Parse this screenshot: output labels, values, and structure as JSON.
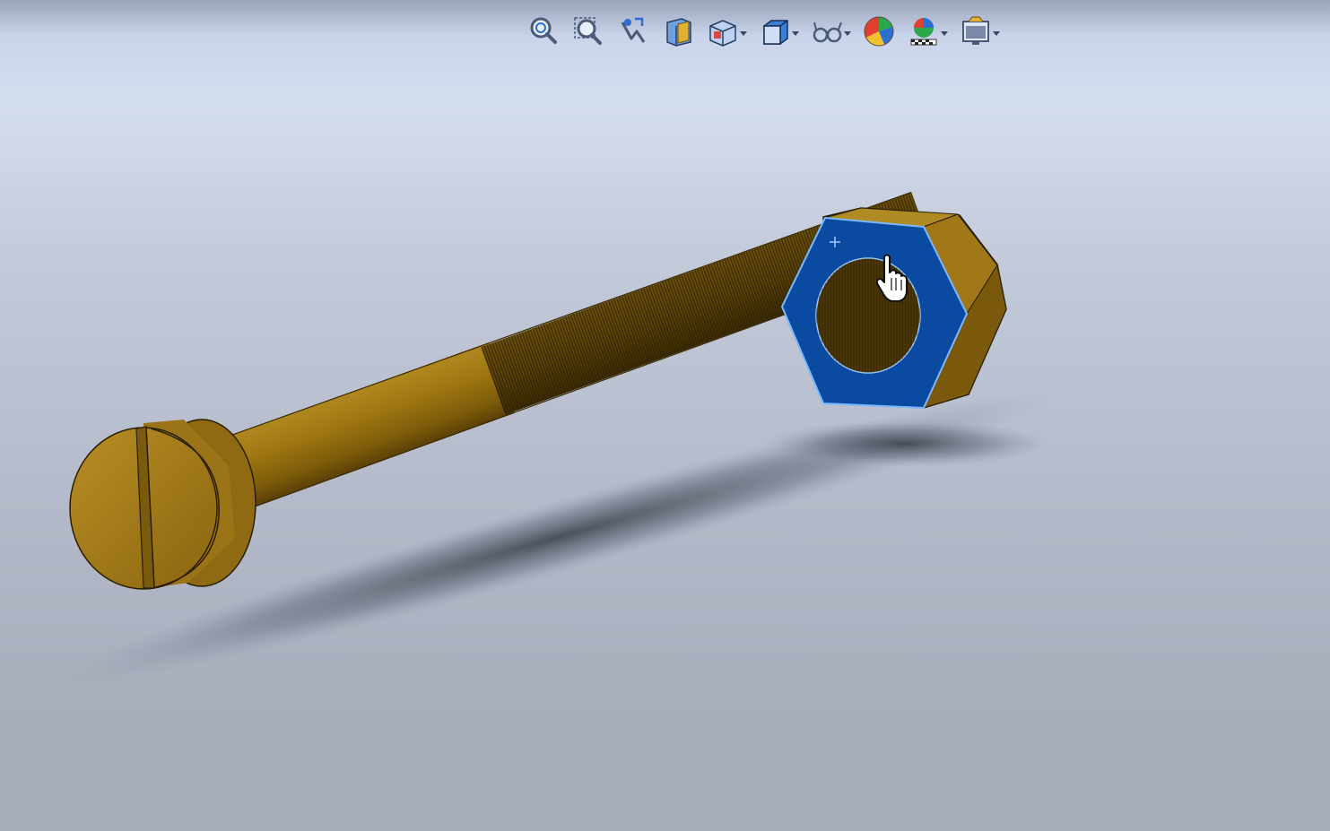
{
  "viewport": {
    "background_top": "#d5deef",
    "background_bottom": "#a6acba"
  },
  "toolbar": {
    "buttons": [
      {
        "name": "zoom-to-fit-icon",
        "dropdown": false
      },
      {
        "name": "zoom-to-area-icon",
        "dropdown": false
      },
      {
        "name": "previous-view-icon",
        "dropdown": false
      },
      {
        "name": "section-view-icon",
        "dropdown": false
      },
      {
        "name": "view-orientation-icon",
        "dropdown": true
      },
      {
        "name": "display-style-icon",
        "dropdown": true
      },
      {
        "name": "hide-show-items-icon",
        "dropdown": true
      },
      {
        "name": "edit-appearance-icon",
        "dropdown": false
      },
      {
        "name": "apply-scene-icon",
        "dropdown": true
      },
      {
        "name": "view-settings-icon",
        "dropdown": true
      }
    ]
  },
  "model": {
    "part": "slotted-screw-with-hex-nut",
    "body_color": "#8f6a12",
    "selection_color": "#0a4aa0",
    "selected_face": "hex-nut-front-face"
  },
  "cursor": {
    "type": "hand-pointer-icon"
  }
}
